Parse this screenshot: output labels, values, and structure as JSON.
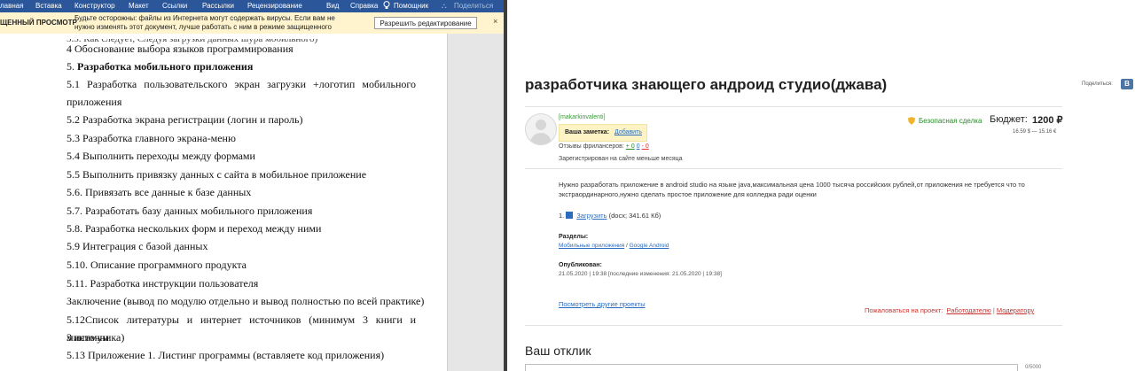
{
  "word": {
    "ribbon_tabs": [
      "лавная",
      "Вставка",
      "Конструктор",
      "Макет",
      "Ссылки",
      "Рассылки",
      "Рецензирование",
      "Вид",
      "Справка",
      "Помощник",
      "Поделиться"
    ],
    "protected_view": {
      "label": "ЩЕННЫЙ ПРОСМОТР",
      "message": "Будьте осторожны: файлы из Интернета могут содержать вирусы. Если вам не нужно изменять этот документ, лучше работать с ним в режиме защищенного просмотра.",
      "button": "Разрешить редактирование",
      "close": "×"
    },
    "overlap_text": "5.3. Как следует, Следуя загрузки данных шура мобильного)",
    "lines": [
      "4 Обоснование выбора языков программирования",
      "5.",
      "Разработка мобильного приложения",
      "5.1 Разработка пользовательского экран загрузки +логотип мобильного",
      "приложения",
      "5.2 Разработка экрана регистрации (логин и пароль)",
      "5.3 Разработка главного экрана-меню",
      "5.4 Выполнить переходы между формами",
      "5.5 Выполнить привязку данных с сайта в мобильное приложение",
      "5.6. Привязать все данные к базе данных",
      "5.7. Разработать базу данных мобильного приложения",
      "5.8.  Разработка нескольких форм и переход между ними",
      "5.9   Интеграция с базой данных",
      "5.10. Описание программного продукта",
      "5.11. Разработка инструкции пользователя",
      "Заключение (вывод по модулю отдельно и вывод полностью по всей практике)",
      "5.12Список литературы и интернет источников (минимум 3 книги и минимум",
      "3 источника)",
      "5.13 Приложение 1. Листинг программы (вставляете код приложения)"
    ]
  },
  "site": {
    "title": "разработчика знающего андроид студио(джава)",
    "share_label": "Поделиться:",
    "share_icon": "В",
    "username": "[makarkinvalenti]",
    "note_label": "Ваша заметка:",
    "note_add": "Добавить",
    "reviews_label": "Отзывы фрилансеров:",
    "reviews_pos": "+ 0",
    "reviews_neu": "0",
    "reviews_neg": "- 0",
    "registered": "Зарегистрирован на сайте меньше месяца",
    "safe_deal": "Безопасная сделка",
    "budget_label": "Бюджет:",
    "budget_value": "1200 ₽",
    "budget_sub": "16.59 $ — 15.16 €",
    "description": "Нужно разработать приложение в android studio на языке java,максимальная цена 1000 тысяча российских рублей,от приложения не требуется что то экстраординарного,нужно сделать простое приложение для колледжа ради оценки",
    "attachment": {
      "index": "1.",
      "link": "Загрузить",
      "info": "(docx; 341.61 Кб)"
    },
    "sections_label": "Разделы:",
    "sections": [
      "Мобильные приложения",
      "Google Android"
    ],
    "sections_sep": " / ",
    "published_label": "Опубликован:",
    "published_date": "21.05.2020 | 19:38 [последние изменения: 21.05.2020 | 19:38]",
    "other_projects": "Посмотреть другие проекты",
    "complain_label": "Пожаловаться на проект:",
    "complain_employer": "Работодателю",
    "complain_sep": "|",
    "complain_moderator": "Модератору",
    "response_title": "Ваш отклик",
    "response_placeholder": "",
    "response_counter": "0/5000"
  },
  "colors": {
    "ribbon": "#2b579a",
    "protected_bar": "#fff4ce",
    "link": "#2a6cc1",
    "green": "#2a8a2a",
    "red": "#c9302c"
  }
}
